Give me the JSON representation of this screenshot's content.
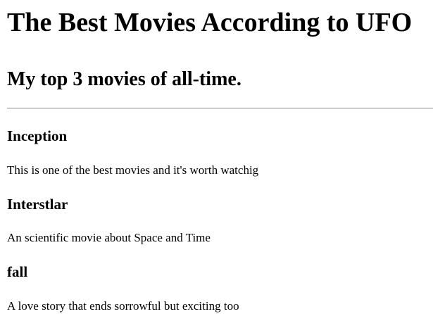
{
  "header": {
    "title": "The Best Movies According to UFO",
    "subtitle": "My top 3 movies of all-time."
  },
  "movies": [
    {
      "title": "Inception",
      "description": "This is one of the best movies and it's worth watchig"
    },
    {
      "title": "Interstlar",
      "description": "An scientific movie about Space and Time"
    },
    {
      "title": "fall",
      "description": "A love story that ends sorrowful but exciting too"
    }
  ]
}
